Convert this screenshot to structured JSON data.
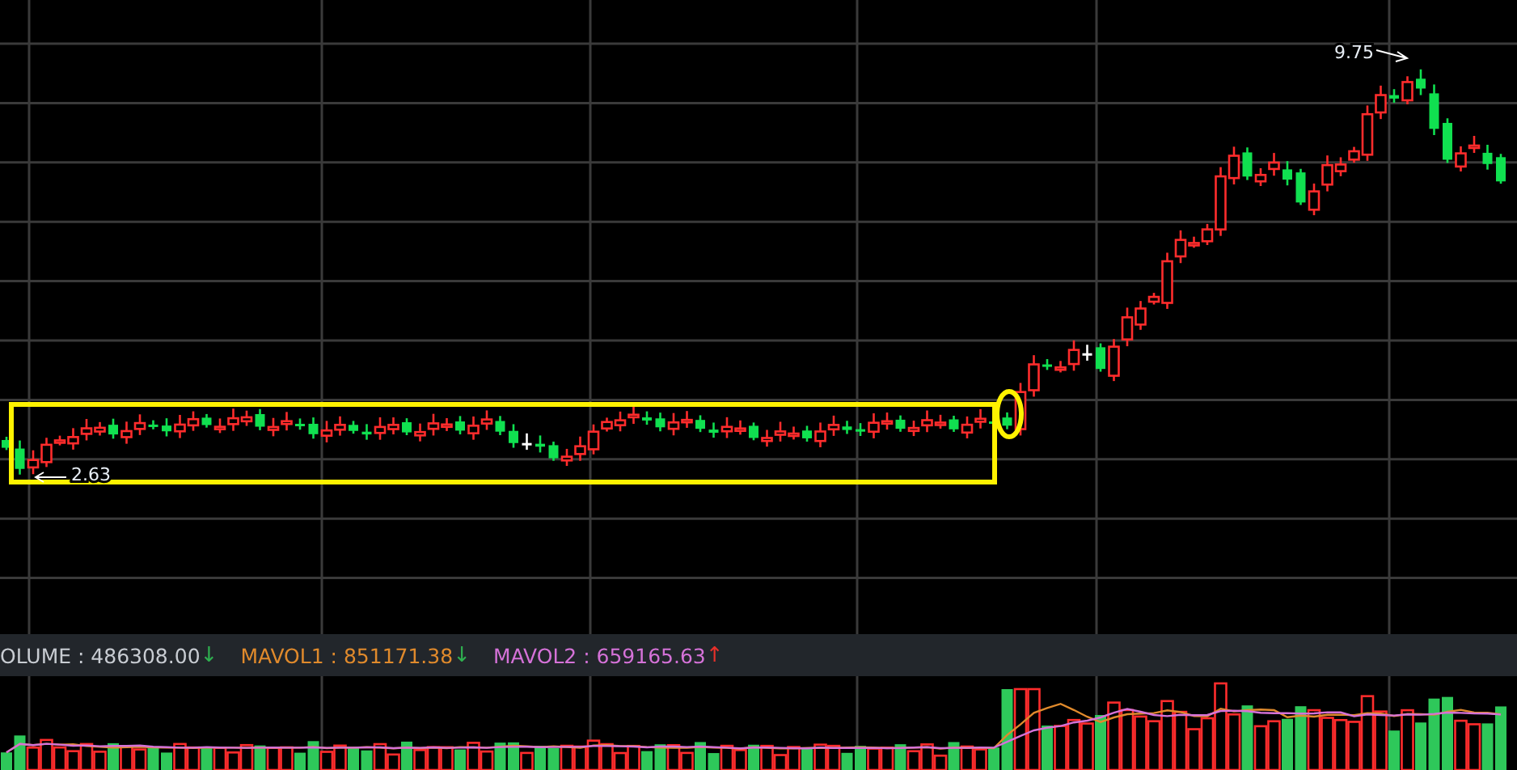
{
  "price_chart": {
    "annotations": [
      {
        "kind": "high",
        "label": "9.75"
      },
      {
        "kind": "low",
        "label": "2.63"
      }
    ]
  },
  "volume_legend": [
    {
      "kind": "value",
      "text": "OLUME : 486308.00",
      "color": "#c8ccd2"
    },
    {
      "kind": "arrow",
      "text": "↓",
      "color": "#2fb050"
    },
    {
      "kind": "value",
      "text": "MAVOL1 : 851171.38",
      "color": "#e08a2c"
    },
    {
      "kind": "arrow",
      "text": "↓",
      "color": "#2fb050"
    },
    {
      "kind": "value",
      "text": "MAVOL2 : 659165.63",
      "color": "#d572d8"
    },
    {
      "kind": "arrow",
      "text": "↑",
      "color": "#e8302a"
    }
  ]
}
